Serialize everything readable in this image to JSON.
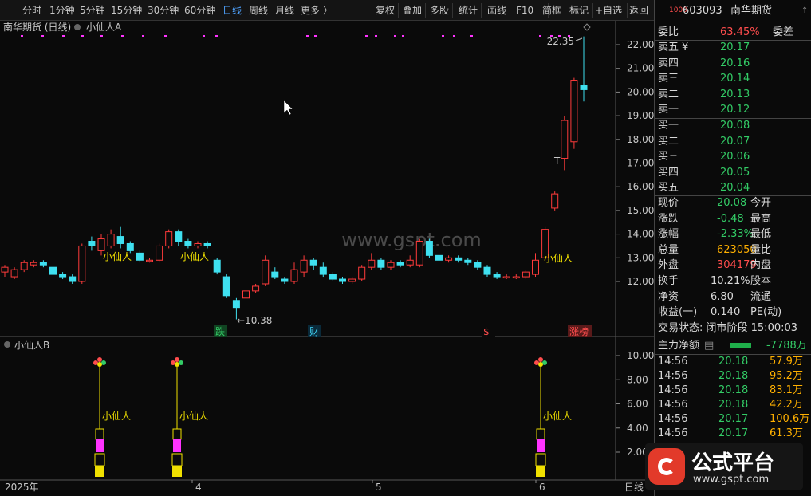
{
  "toolbar": {
    "periods": [
      "分时",
      "1分钟",
      "5分钟",
      "15分钟",
      "30分钟",
      "60分钟",
      "日线",
      "周线",
      "月线",
      "更多 〉"
    ],
    "active_period": "日线",
    "actions": [
      "复权",
      "叠加",
      "多股",
      "统计",
      "画线",
      "F10",
      "简框",
      "标记",
      "+自选",
      "返回"
    ]
  },
  "chart": {
    "title": "南华期货 (日线)",
    "indicator_a": "小仙人A",
    "indicator_b": "小仙人B",
    "watermark": "www.gspt.com",
    "high_label": "22.35",
    "low_label": "←10.38",
    "marker_label": "小仙人",
    "t_marker": "T",
    "events": [
      "跌",
      "财",
      "$",
      "涨榜"
    ],
    "colors": {
      "up": "#ff3b3b",
      "down": "#3fe0f0",
      "bg": "#0a0a0a",
      "magenta": "#ff33ff",
      "yellow": "#f0e000"
    },
    "price_axis": [
      "22.00",
      "21.00",
      "20.00",
      "19.00",
      "18.00",
      "17.00",
      "16.00",
      "15.00",
      "14.00",
      "13.00",
      "12.00"
    ],
    "sub_axis": [
      "10.00",
      "8.00",
      "6.00",
      "4.00",
      "2.00"
    ],
    "date_axis": [
      "2025年",
      "4",
      "5",
      "6"
    ],
    "bottom_right": "日线"
  },
  "chart_data": {
    "type": "candlestick",
    "title": "南华期货 (日线)",
    "ylim": [
      11.2,
      22.9
    ],
    "candles": [
      [
        12.4,
        12.6,
        12.2,
        12.7
      ],
      [
        12.2,
        12.5,
        12.1,
        12.6
      ],
      [
        12.5,
        12.8,
        12.4,
        12.9
      ],
      [
        12.7,
        12.8,
        12.6,
        12.9
      ],
      [
        12.8,
        12.7,
        12.6,
        12.9
      ],
      [
        12.6,
        12.3,
        12.2,
        12.7
      ],
      [
        12.3,
        12.2,
        12.1,
        12.4
      ],
      [
        12.2,
        12.0,
        11.9,
        12.3
      ],
      [
        12.0,
        13.5,
        11.9,
        13.6
      ],
      [
        13.7,
        13.5,
        13.3,
        13.9
      ],
      [
        13.3,
        13.8,
        13.1,
        14.0
      ],
      [
        13.5,
        14.0,
        13.4,
        14.2
      ],
      [
        13.9,
        13.6,
        13.4,
        14.3
      ],
      [
        13.6,
        13.3,
        13.2,
        13.7
      ],
      [
        13.2,
        12.9,
        12.8,
        13.3
      ],
      [
        12.9,
        12.9,
        12.8,
        13.0
      ],
      [
        12.9,
        13.5,
        12.8,
        13.6
      ],
      [
        13.5,
        14.1,
        13.4,
        14.2
      ],
      [
        14.1,
        13.7,
        13.5,
        14.2
      ],
      [
        13.7,
        13.5,
        13.4,
        13.8
      ],
      [
        13.5,
        13.6,
        13.4,
        13.7
      ],
      [
        13.6,
        13.5,
        13.4,
        13.7
      ],
      [
        12.9,
        12.4,
        12.3,
        13.0
      ],
      [
        12.2,
        11.4,
        11.3,
        12.3
      ],
      [
        11.2,
        10.9,
        10.4,
        11.3
      ],
      [
        11.3,
        11.6,
        11.1,
        11.7
      ],
      [
        11.6,
        11.8,
        11.5,
        11.9
      ],
      [
        11.9,
        12.9,
        11.8,
        13.1
      ],
      [
        12.4,
        12.2,
        12.1,
        12.6
      ],
      [
        12.1,
        12.0,
        11.9,
        12.2
      ],
      [
        12.0,
        12.5,
        11.9,
        12.8
      ],
      [
        12.4,
        12.9,
        12.2,
        13.1
      ],
      [
        12.9,
        12.7,
        12.5,
        13.0
      ],
      [
        12.6,
        12.3,
        12.2,
        12.8
      ],
      [
        12.3,
        12.1,
        12.0,
        12.4
      ],
      [
        12.1,
        12.0,
        11.9,
        12.2
      ],
      [
        12.0,
        12.1,
        11.9,
        12.2
      ],
      [
        12.1,
        12.6,
        12.0,
        12.7
      ],
      [
        12.6,
        12.9,
        12.5,
        13.2
      ],
      [
        12.9,
        12.6,
        12.5,
        13.0
      ],
      [
        12.6,
        12.8,
        12.5,
        12.9
      ],
      [
        12.8,
        12.7,
        12.6,
        12.9
      ],
      [
        12.7,
        12.9,
        12.6,
        13.1
      ],
      [
        12.7,
        13.7,
        12.6,
        13.8
      ],
      [
        13.7,
        13.1,
        13.0,
        13.8
      ],
      [
        13.1,
        12.9,
        12.8,
        13.2
      ],
      [
        12.9,
        13.0,
        12.8,
        13.1
      ],
      [
        13.0,
        12.9,
        12.8,
        13.1
      ],
      [
        12.9,
        12.8,
        12.7,
        13.0
      ],
      [
        12.8,
        12.6,
        12.5,
        12.9
      ],
      [
        12.6,
        12.3,
        12.2,
        12.7
      ],
      [
        12.3,
        12.2,
        12.1,
        12.4
      ],
      [
        12.2,
        12.2,
        12.1,
        12.3
      ],
      [
        12.2,
        12.2,
        12.1,
        12.3
      ],
      [
        12.2,
        12.4,
        12.1,
        12.5
      ],
      [
        12.3,
        12.9,
        12.2,
        13.2
      ],
      [
        13.0,
        14.2,
        12.9,
        14.3
      ],
      [
        15.1,
        15.7,
        15.0,
        15.8
      ],
      [
        17.2,
        18.8,
        16.7,
        19.0
      ],
      [
        17.9,
        20.5,
        17.6,
        20.6
      ],
      [
        20.3,
        20.1,
        19.6,
        22.35
      ]
    ],
    "low_mark": 10.38,
    "high_mark": 22.35
  },
  "quote": {
    "code": "603093",
    "name": "南华期货",
    "weibi_label": "委比",
    "weibi": "63.45%",
    "weicha_label": "委差",
    "asks": [
      {
        "label": "卖五",
        "price": "20.17"
      },
      {
        "label": "卖四",
        "price": "20.16"
      },
      {
        "label": "卖三",
        "price": "20.14"
      },
      {
        "label": "卖二",
        "price": "20.13"
      },
      {
        "label": "卖一",
        "price": "20.12"
      }
    ],
    "bids": [
      {
        "label": "买一",
        "price": "20.08"
      },
      {
        "label": "买二",
        "price": "20.07"
      },
      {
        "label": "买三",
        "price": "20.06"
      },
      {
        "label": "买四",
        "price": "20.05"
      },
      {
        "label": "买五",
        "price": "20.04"
      }
    ],
    "yen": "¥",
    "stats": [
      {
        "l": "现价",
        "v": "20.08",
        "c": "green",
        "r": "今开"
      },
      {
        "l": "涨跌",
        "v": "-0.48",
        "c": "green",
        "r": "最高"
      },
      {
        "l": "涨幅",
        "v": "-2.33%",
        "c": "green",
        "r": "最低"
      },
      {
        "l": "总量",
        "v": "623050",
        "c": "orange",
        "r": "量比"
      },
      {
        "l": "外盘",
        "v": "304179",
        "c": "red",
        "r": "内盘"
      }
    ],
    "stats2": [
      {
        "l": "换手",
        "v": "10.21%",
        "r": "股本"
      },
      {
        "l": "净资",
        "v": "6.80",
        "r": "流通"
      },
      {
        "l": "收益(一)",
        "v": "0.140",
        "r": "PE(动)"
      }
    ],
    "status": "交易状态: 闭市阶段 15:00:03",
    "flow_label": "主力净额",
    "flow_value": "-7788万",
    "ticks": [
      {
        "t": "14:56",
        "p": "20.18",
        "v": "57.9万"
      },
      {
        "t": "14:56",
        "p": "20.18",
        "v": "95.2万"
      },
      {
        "t": "14:56",
        "p": "20.18",
        "v": "83.1万"
      },
      {
        "t": "14:56",
        "p": "20.18",
        "v": "42.2万"
      },
      {
        "t": "14:56",
        "p": "20.17",
        "v": "100.6万"
      },
      {
        "t": "14:56",
        "p": "20.17",
        "v": "61.3万"
      }
    ],
    "logo_text": "公式平台",
    "logo_url": "www.gspt.com"
  }
}
